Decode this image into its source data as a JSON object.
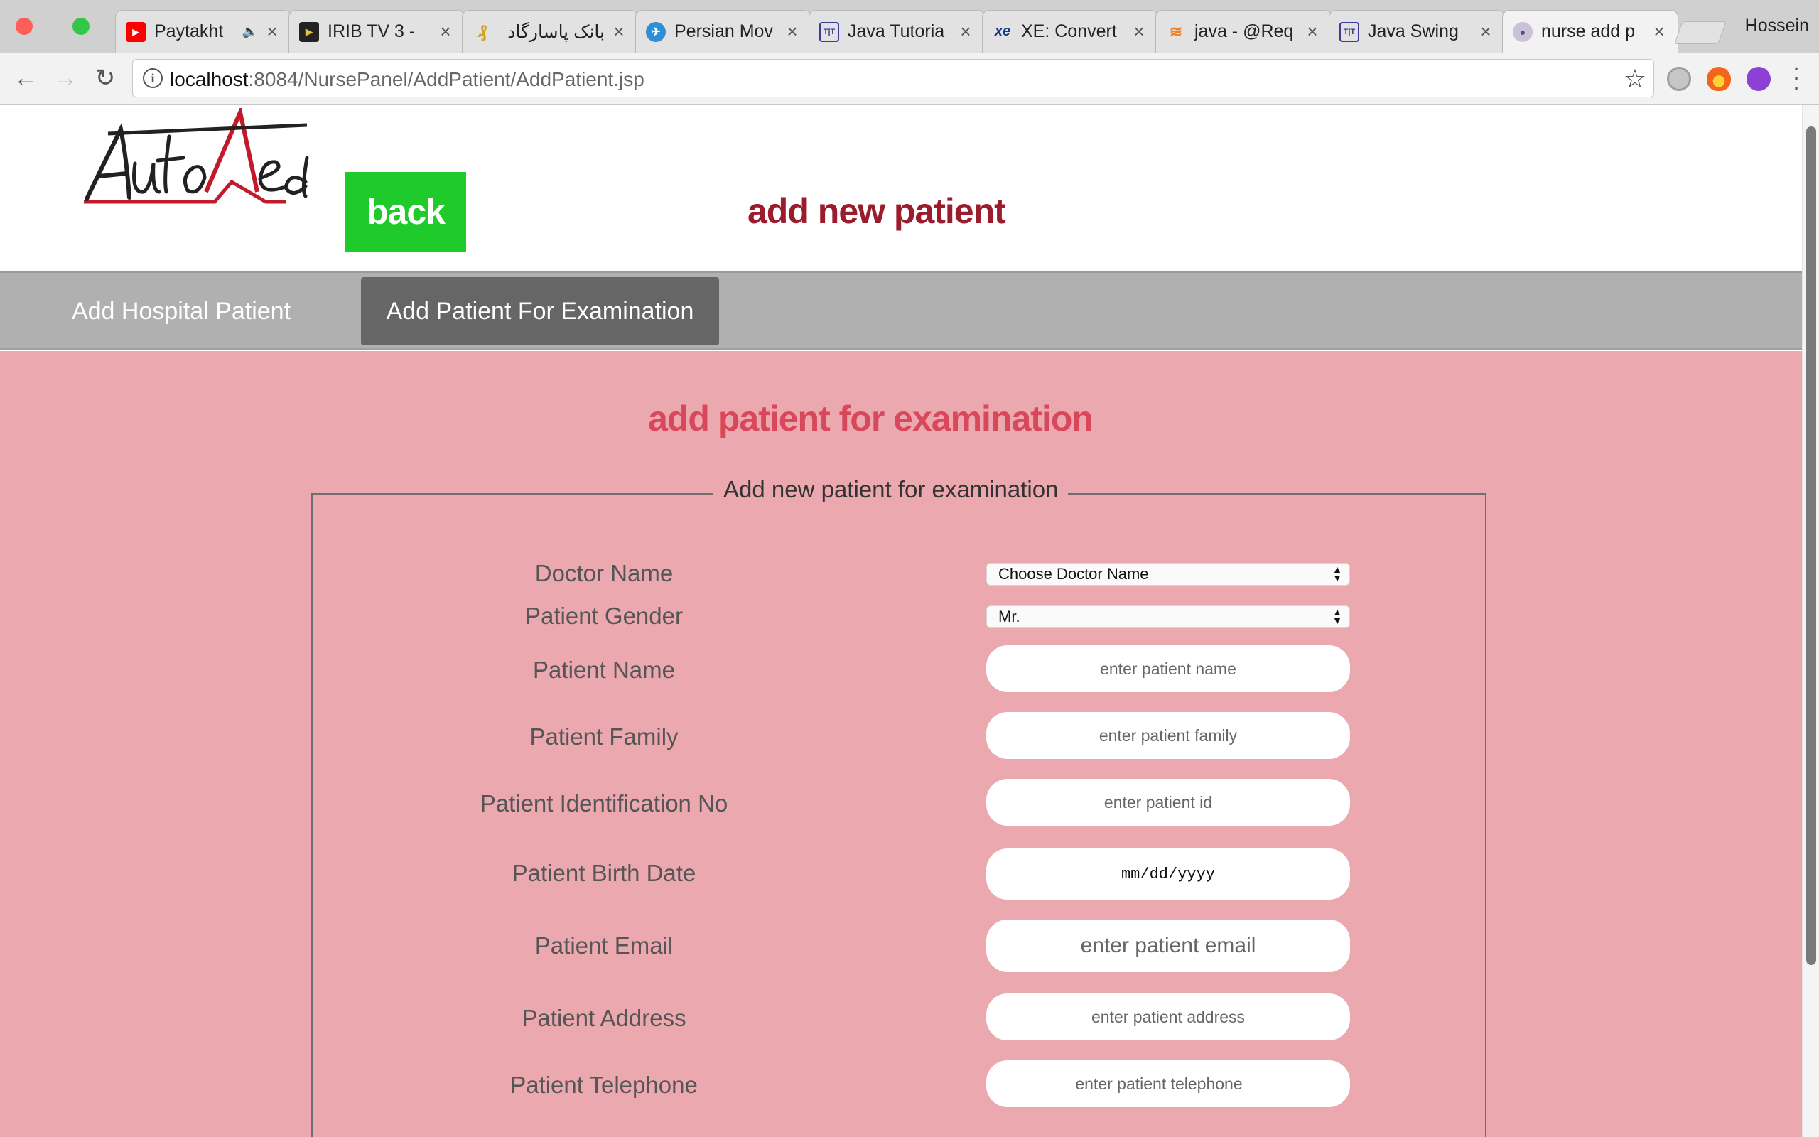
{
  "browser": {
    "tabs": [
      {
        "title": "Paytakht",
        "favicon": "youtube-icon",
        "audio": true
      },
      {
        "title": "IRIB TV 3 - ",
        "favicon": "play-icon"
      },
      {
        "title": "بانک پاسارگاد ::",
        "favicon": "bank-icon"
      },
      {
        "title": "Persian Mov",
        "favicon": "globe-icon"
      },
      {
        "title": "Java Tutoria",
        "favicon": "tutorial-icon"
      },
      {
        "title": "XE: Convert",
        "favicon": "xe-icon"
      },
      {
        "title": "java - @Req",
        "favicon": "stackoverflow-icon"
      },
      {
        "title": "Java Swing",
        "favicon": "tutorial-icon"
      },
      {
        "title": "nurse add p",
        "favicon": "avatar-icon",
        "active": true
      }
    ],
    "profile_name": "Hossein",
    "url_host": "localhost",
    "url_path": ":8084/NursePanel/AddPatient/AddPatient.jsp"
  },
  "header": {
    "logo_text": "AutoMed",
    "back_label": "back",
    "title": "add new patient"
  },
  "nav": {
    "tabs": [
      {
        "label": "Add Hospital Patient",
        "active": false
      },
      {
        "label": "Add Patient For Examination",
        "active": true
      }
    ]
  },
  "main": {
    "section_title": "add patient for examination",
    "legend": "Add new patient for examination",
    "fields": [
      {
        "label": "Doctor Name",
        "type": "select",
        "value": "Choose Doctor Name"
      },
      {
        "label": "Patient Gender",
        "type": "select",
        "value": "Mr."
      },
      {
        "label": "Patient Name",
        "type": "text",
        "placeholder": "enter patient name"
      },
      {
        "label": "Patient Family",
        "type": "text",
        "placeholder": "enter patient family"
      },
      {
        "label": "Patient Identification No",
        "type": "text",
        "placeholder": "enter patient id"
      },
      {
        "label": "Patient Birth Date",
        "type": "date",
        "placeholder": "mm/dd/yyyy"
      },
      {
        "label": "Patient Email",
        "type": "text",
        "placeholder": "enter patient email"
      },
      {
        "label": "Patient Address",
        "type": "text",
        "placeholder": "enter patient address"
      },
      {
        "label": "Patient Telephone",
        "type": "text",
        "placeholder": "enter patient telephone"
      }
    ]
  },
  "colors": {
    "back_button": "#1fcb2a",
    "page_title": "#9b1c2c",
    "section_title": "#d8475a",
    "content_bg": "#eba8ae",
    "nav_bg": "#b0b0b0",
    "nav_active": "#666666"
  }
}
